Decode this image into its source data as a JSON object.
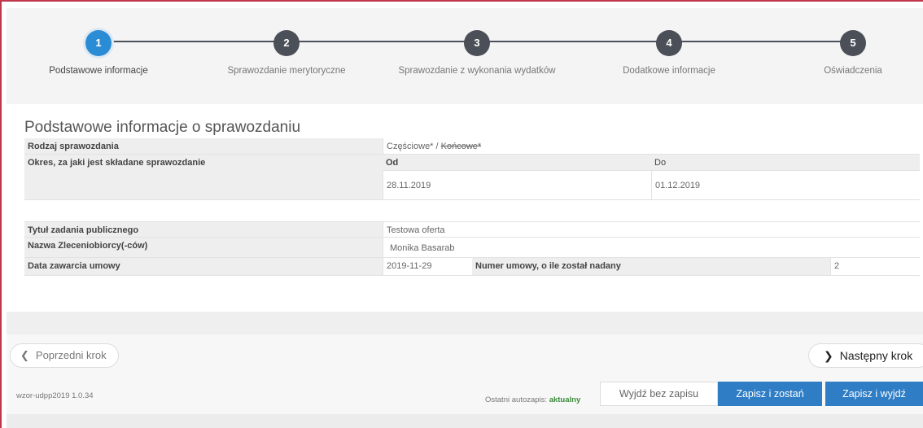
{
  "steps": [
    {
      "number": "1",
      "label": "Podstawowe informacje",
      "active": true
    },
    {
      "number": "2",
      "label": "Sprawozdanie merytoryczne",
      "active": false
    },
    {
      "number": "3",
      "label": "Sprawozdanie z wykonania wydatków",
      "active": false
    },
    {
      "number": "4",
      "label": "Dodatkowe informacje",
      "active": false
    },
    {
      "number": "5",
      "label": "Oświadczenia",
      "active": false
    }
  ],
  "section": {
    "title": "Podstawowe informacje o sprawozdaniu",
    "rodzaj_label": "Rodzaj sprawozdania",
    "rodzaj_value_partial": "Częściowe*",
    "rodzaj_separator": " / ",
    "rodzaj_value_final": "Końcowe*",
    "okres_label": "Okres, za jaki jest składane sprawozdanie",
    "od_label": "Od",
    "do_label": "Do",
    "od_value": "28.11.2019",
    "do_value": "01.12.2019",
    "tytul_label": "Tytuł zadania publicznego",
    "tytul_value": "Testowa oferta",
    "nazwa_label": "Nazwa Zleceniobiorcy(-ców)",
    "nazwa_value": "Monika Basarab",
    "data_label": "Data zawarcia umowy",
    "data_value": "2019-11-29",
    "numer_label": "Numer umowy, o ile został nadany",
    "numer_value": "2"
  },
  "footer": {
    "prev_label": "Poprzedni krok",
    "next_label": "Następny krok",
    "version": "wzor-udpp2019 1.0.34",
    "autosave_label": "Ostatni autozapis:",
    "autosave_status": "aktualny",
    "exit_label": "Wyjdź bez zapisu",
    "save_stay_label": "Zapisz i zostań",
    "save_exit_label": "Zapisz i wyjdź"
  },
  "colors": {
    "active_step": "#2b8cd6",
    "inactive_step": "#4b4f57",
    "primary_button": "#2e7dc5",
    "frame_accent": "#c0364b"
  },
  "icons": {
    "prev": "chevron-left-icon",
    "next": "chevron-right-icon"
  }
}
